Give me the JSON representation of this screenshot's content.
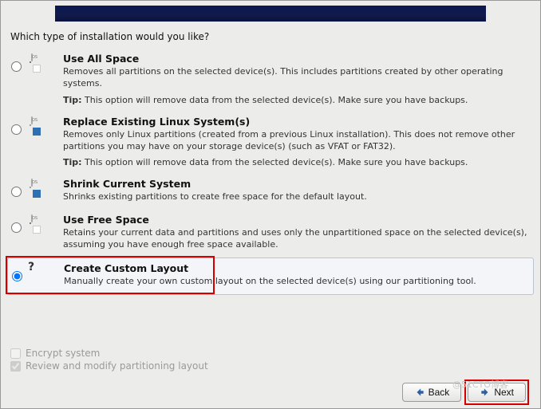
{
  "prompt": "Which type of installation would you like?",
  "options": [
    {
      "title": "Use All Space",
      "desc": "Removes all partitions on the selected device(s).  This includes partitions created by other operating systems.",
      "tip_label": "Tip:",
      "tip": " This option will remove data from the selected device(s).  Make sure you have backups."
    },
    {
      "title": "Replace Existing Linux System(s)",
      "desc": "Removes only Linux partitions (created from a previous Linux installation).  This does not remove other partitions you may have on your storage device(s) (such as VFAT or FAT32).",
      "tip_label": "Tip:",
      "tip": " This option will remove data from the selected device(s).  Make sure you have backups."
    },
    {
      "title": "Shrink Current System",
      "desc": "Shrinks existing partitions to create free space for the default layout."
    },
    {
      "title": "Use Free Space",
      "desc": "Retains your current data and partitions and uses only the unpartitioned space on the selected device(s), assuming you have enough free space available."
    },
    {
      "title": "Create Custom Layout",
      "desc": "Manually create your own custom layout on the selected device(s) using our partitioning tool."
    }
  ],
  "checks": {
    "encrypt": "Encrypt system",
    "review": "Review and modify partitioning layout"
  },
  "buttons": {
    "back": "Back",
    "next": "Next"
  },
  "watermark": "@51CTO博客"
}
